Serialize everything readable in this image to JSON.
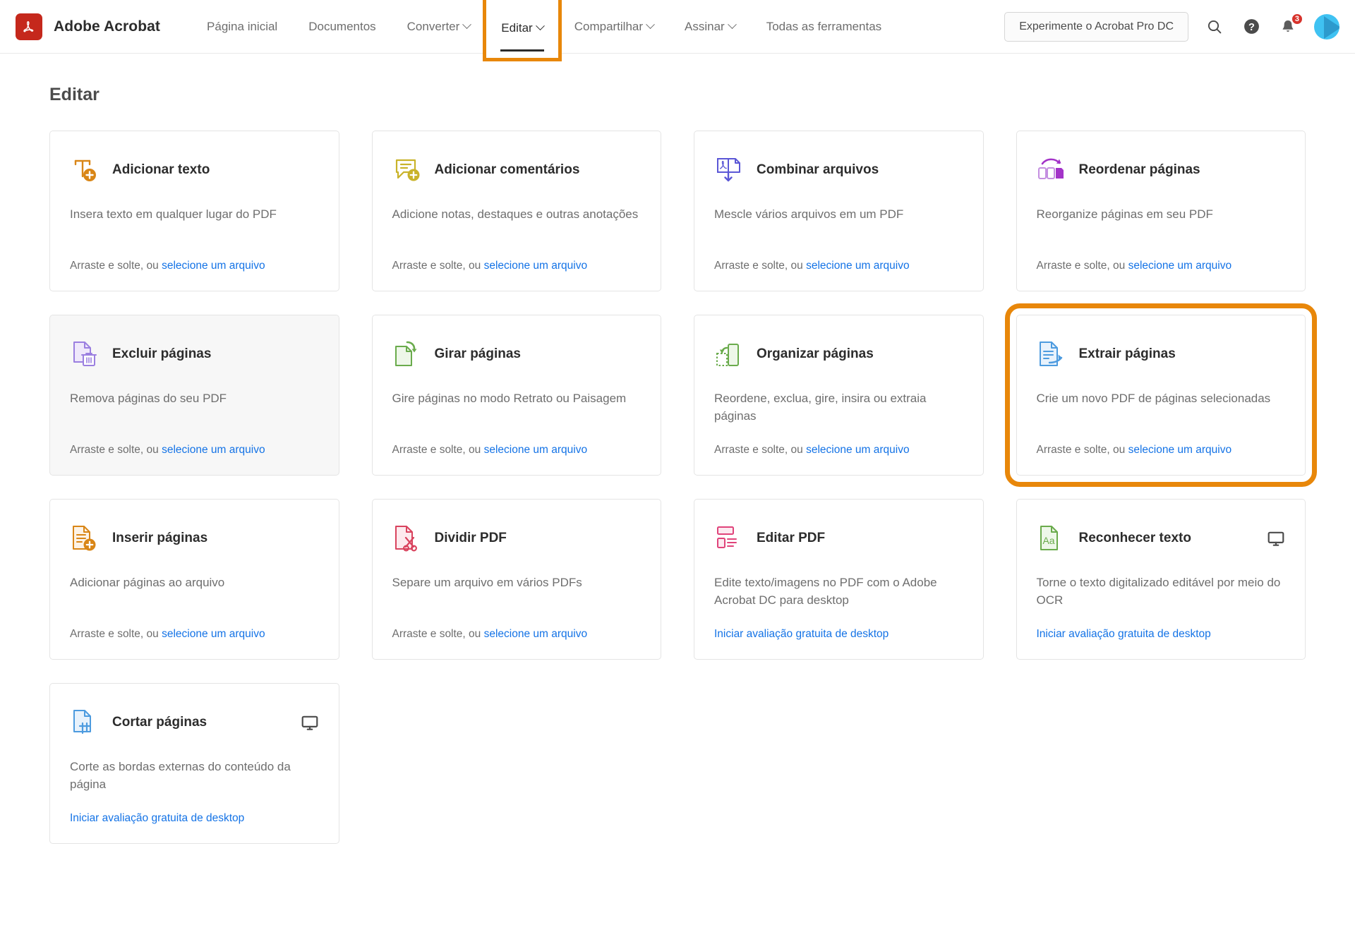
{
  "header": {
    "brand_name": "Adobe Acrobat",
    "logo_icon": "acrobat-logo",
    "nav": [
      {
        "label": "Página inicial",
        "has_caret": false,
        "active": false,
        "highlighted": false
      },
      {
        "label": "Documentos",
        "has_caret": false,
        "active": false,
        "highlighted": false
      },
      {
        "label": "Converter",
        "has_caret": true,
        "active": false,
        "highlighted": false
      },
      {
        "label": "Editar",
        "has_caret": true,
        "active": true,
        "highlighted": true
      },
      {
        "label": "Compartilhar",
        "has_caret": true,
        "active": false,
        "highlighted": false
      },
      {
        "label": "Assinar",
        "has_caret": true,
        "active": false,
        "highlighted": false
      },
      {
        "label": "Todas as ferramentas",
        "has_caret": false,
        "active": false,
        "highlighted": false
      }
    ],
    "try_pro_label": "Experimente o Acrobat Pro DC",
    "search_icon": "search-icon",
    "help_icon": "help-icon",
    "bell_icon": "bell-icon",
    "notification_count": "3",
    "avatar_icon": "user-avatar"
  },
  "page": {
    "title": "Editar"
  },
  "common": {
    "drag_prefix": "Arraste e solte, ou ",
    "select_file_link": "selecione um arquivo",
    "trial_link": "Iniciar avaliação gratuita de desktop"
  },
  "colors": {
    "accent_orange": "#e8870a",
    "link_blue": "#1473e6",
    "brand_red": "#c5281c"
  },
  "cards": [
    {
      "title": "Adicionar texto",
      "desc": "Insera texto em qualquer lugar do PDF",
      "footer_type": "drag",
      "icon": "add-text-icon",
      "color": "#d98617",
      "state": "normal",
      "desktop": false
    },
    {
      "title": "Adicionar comentários",
      "desc": "Adicione notas, destaques e outras anotações",
      "footer_type": "drag",
      "icon": "add-comment-icon",
      "color": "#c9b32a",
      "state": "normal",
      "desktop": false
    },
    {
      "title": "Combinar arquivos",
      "desc": "Mescle vários arquivos em um PDF",
      "footer_type": "drag",
      "icon": "combine-files-icon",
      "color": "#5b57d6",
      "state": "normal",
      "desktop": false
    },
    {
      "title": "Reordenar páginas",
      "desc": "Reorganize páginas em seu PDF",
      "footer_type": "drag",
      "icon": "reorder-pages-icon",
      "color": "#a333c8",
      "state": "normal",
      "desktop": false
    },
    {
      "title": "Excluir páginas",
      "desc": "Remova páginas do seu PDF",
      "footer_type": "drag",
      "icon": "delete-pages-icon",
      "color": "#9b7fe0",
      "state": "hovered",
      "desktop": false
    },
    {
      "title": "Girar páginas",
      "desc": "Gire páginas no modo Retrato ou Paisagem",
      "footer_type": "drag",
      "icon": "rotate-pages-icon",
      "color": "#6aab4c",
      "state": "normal",
      "desktop": false
    },
    {
      "title": "Organizar páginas",
      "desc": "Reordene, exclua, gire, insira ou extraia páginas",
      "footer_type": "drag",
      "icon": "organize-pages-icon",
      "color": "#6aab4c",
      "state": "normal",
      "desktop": false
    },
    {
      "title": "Extrair páginas",
      "desc": "Crie um novo PDF de páginas selecionadas",
      "footer_type": "drag",
      "icon": "extract-pages-icon",
      "color": "#4d9bdf",
      "state": "highlighted",
      "desktop": false
    },
    {
      "title": "Inserir páginas",
      "desc": "Adicionar páginas ao arquivo",
      "footer_type": "drag",
      "icon": "insert-pages-icon",
      "color": "#d98617",
      "state": "normal",
      "desktop": false
    },
    {
      "title": "Dividir PDF",
      "desc": "Separe um arquivo em vários PDFs",
      "footer_type": "drag",
      "icon": "split-pdf-icon",
      "color": "#d9435e",
      "state": "normal",
      "desktop": false
    },
    {
      "title": "Editar PDF",
      "desc": "Edite texto/imagens no PDF com o Adobe Acrobat DC para desktop",
      "footer_type": "trial",
      "icon": "edit-pdf-icon",
      "color": "#e0437a",
      "state": "normal",
      "desktop": false
    },
    {
      "title": "Reconhecer texto",
      "desc": "Torne o texto digitalizado editável por meio do OCR",
      "footer_type": "trial",
      "icon": "recognize-text-icon",
      "color": "#6aab4c",
      "state": "normal",
      "desktop": true
    },
    {
      "title": "Cortar páginas",
      "desc": "Corte as bordas externas do conteúdo da página",
      "footer_type": "trial",
      "icon": "crop-pages-icon",
      "color": "#4d9bdf",
      "state": "normal",
      "desktop": true
    }
  ]
}
